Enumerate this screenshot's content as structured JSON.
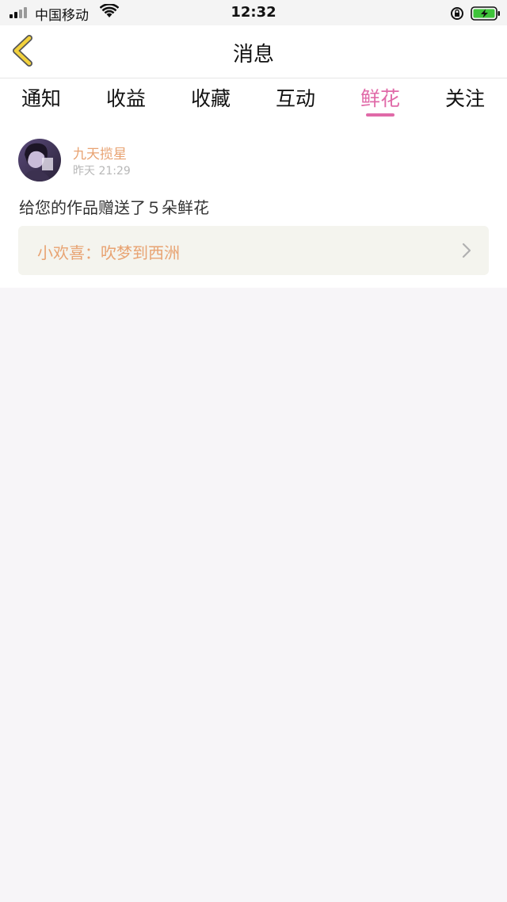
{
  "status_bar": {
    "carrier": "中国移动",
    "time": "12:32"
  },
  "nav": {
    "title": "消息"
  },
  "tabs": [
    {
      "label": "通知",
      "active": false
    },
    {
      "label": "收益",
      "active": false
    },
    {
      "label": "收藏",
      "active": false
    },
    {
      "label": "互动",
      "active": false
    },
    {
      "label": "鲜花",
      "active": true
    },
    {
      "label": "关注",
      "active": false
    }
  ],
  "notification": {
    "username": "九天揽星",
    "timestamp": "昨天 21:29",
    "message": "给您的作品赠送了５朵鲜花",
    "work_link": "小欢喜：吹梦到西洲"
  },
  "colors": {
    "accent": "#e06aa8",
    "username": "#e8a372",
    "back_icon": "#f2d13c"
  }
}
